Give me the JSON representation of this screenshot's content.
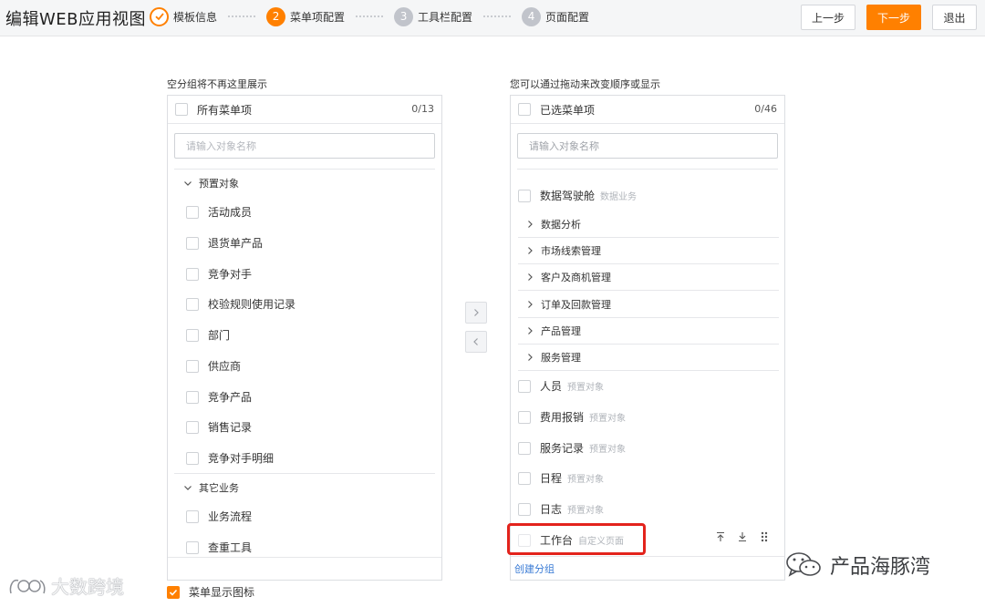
{
  "header": {
    "title": "编辑WEB应用视图",
    "steps": [
      {
        "num": "1",
        "label": "模板信息",
        "state": "done"
      },
      {
        "num": "2",
        "label": "菜单项配置",
        "state": "active"
      },
      {
        "num": "3",
        "label": "工具栏配置",
        "state": "todo"
      },
      {
        "num": "4",
        "label": "页面配置",
        "state": "todo"
      }
    ],
    "prev_label": "上一步",
    "next_label": "下一步",
    "exit_label": "退出"
  },
  "left": {
    "caption": "空分组将不再这里展示",
    "head_title": "所有菜单项",
    "count": "0/13",
    "search_placeholder": "请输入对象名称",
    "group1": "预置对象",
    "group1_items": [
      "活动成员",
      "退货单产品",
      "竞争对手",
      "校验规则使用记录",
      "部门",
      "供应商",
      "竞争产品",
      "销售记录",
      "竞争对手明细"
    ],
    "group2": "其它业务",
    "group2_items": [
      "业务流程",
      "查重工具"
    ]
  },
  "right": {
    "caption": "您可以通过拖动来改变顺序或显示",
    "head_title": "已选菜单项",
    "count": "0/46",
    "search_placeholder": "请输入对象名称",
    "cockpit": {
      "label": "数据驾驶舱",
      "tag": "数据业务"
    },
    "groups": [
      "数据分析",
      "市场线索管理",
      "客户及商机管理",
      "订单及回款管理",
      "产品管理",
      "服务管理"
    ],
    "items": [
      {
        "label": "人员",
        "tag": "预置对象"
      },
      {
        "label": "费用报销",
        "tag": "预置对象"
      },
      {
        "label": "服务记录",
        "tag": "预置对象"
      },
      {
        "label": "日程",
        "tag": "预置对象"
      },
      {
        "label": "日志",
        "tag": "预置对象"
      }
    ],
    "workbench": {
      "label": "工作台",
      "tag": "自定义页面"
    },
    "create_group": "创建分组"
  },
  "show_icons_label": "菜单显示图标",
  "watermarks": {
    "left": "大数跨境",
    "right": "产品海豚湾"
  },
  "colors": {
    "accent": "#ff8000",
    "highlight": "#e3231c",
    "link": "#3a7bd5"
  }
}
